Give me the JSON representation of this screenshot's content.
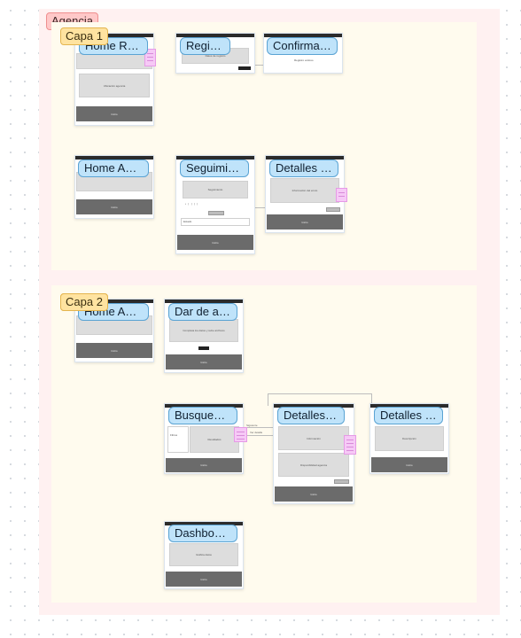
{
  "section": {
    "label": "Agencia"
  },
  "layers": [
    {
      "label": "Capa 1"
    },
    {
      "label": "Capa 2"
    }
  ],
  "frames": [
    {
      "title": "Home Reg...",
      "block_text": "Ubicación agencia",
      "footer_text": "Inicio"
    },
    {
      "title": "Registro",
      "block_text": "Datos de registro"
    },
    {
      "title": "Confirmac...",
      "block_text": "Registro exitoso"
    },
    {
      "title": "Home Age...",
      "footer_text": "Inicio"
    },
    {
      "title": "Seguimie...",
      "block_text": "Seguimiento",
      "field_label": "Estado",
      "footer_text": "Inicio"
    },
    {
      "title": "Detalles d...",
      "block_text": "Información del envío",
      "button_text": "Ver más",
      "footer_text": "Inicio"
    },
    {
      "title": "Home Age...",
      "footer_text": "Inicio"
    },
    {
      "title": "Dar de alt...",
      "block_text": "Completa los datos y sube archivos",
      "footer_text": "Inicio"
    },
    {
      "title": "Busqueda...",
      "side_text": "Filtros",
      "block_text": "Resultados",
      "footer_text": "Inicio"
    },
    {
      "title": "Detalles d...",
      "block_text": "Información",
      "block2_text": "Disponibilidad agencia",
      "footer_text": "Inicio"
    },
    {
      "title": "Detalles d...",
      "block_text": "Descripción",
      "footer_text": "Inicio"
    },
    {
      "title": "Dashboar...",
      "block_text": "Gráfica datos",
      "footer_text": "Inicio"
    }
  ],
  "connectors": [
    {
      "label": "Siguiente"
    },
    {
      "label": "Ver detalle"
    }
  ]
}
